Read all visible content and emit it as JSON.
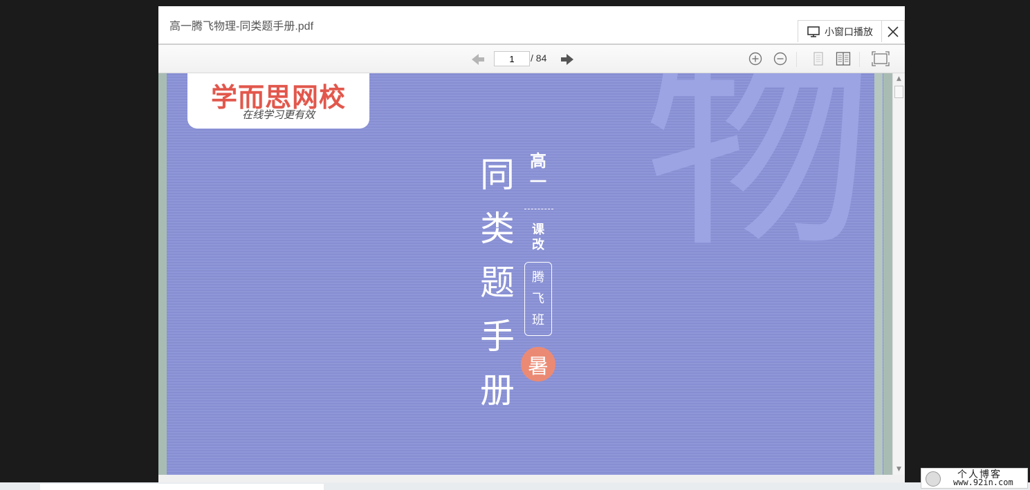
{
  "viewer": {
    "file_title": "高一腾飞物理-同类题手册.pdf",
    "mini_window_label": "小窗口播放"
  },
  "toolbar": {
    "current_page": "1",
    "total_pages": "/ 84"
  },
  "cover": {
    "logo_main": "学而思网校",
    "logo_sub": "在线学习更有效",
    "watermark": "物",
    "title_chars": [
      "同",
      "类",
      "题",
      "手",
      "册"
    ],
    "grade_chars": [
      "高",
      "一"
    ],
    "course_chars": [
      "课",
      "改"
    ],
    "class_chars": [
      "腾",
      "飞",
      "班"
    ],
    "season": "暑"
  },
  "footer_badge": {
    "name": "个人博客",
    "url": "www.92in.com"
  },
  "colors": {
    "cover_bg": "#8b93d8",
    "logo_red": "#e2574c",
    "season_circle": "#eb8a74"
  },
  "icons": [
    "monitor-icon",
    "close-icon",
    "prev-page-icon",
    "next-page-icon",
    "zoom-in-icon",
    "zoom-out-icon",
    "single-page-icon",
    "double-page-icon",
    "fullscreen-icon"
  ]
}
